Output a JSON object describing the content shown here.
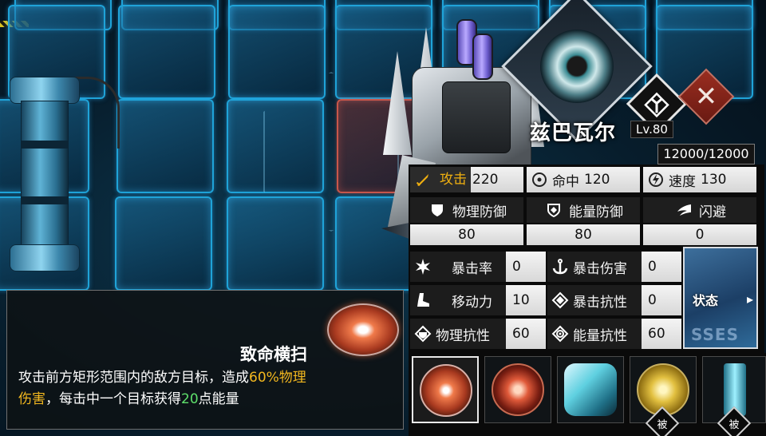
{
  "character": {
    "name": "兹巴瓦尔",
    "level": "Lv.80",
    "hp": "12000/12000"
  },
  "stats": {
    "attack": {
      "label": "攻击",
      "value": "220"
    },
    "accuracy": {
      "label": "命中",
      "value": "120"
    },
    "speed": {
      "label": "速度",
      "value": "130"
    },
    "phys_def": {
      "label": "物理防御",
      "value": "80"
    },
    "energy_def": {
      "label": "能量防御",
      "value": "80"
    },
    "evasion": {
      "label": "闪避",
      "value": "0"
    },
    "crit_rate": {
      "label": "暴击率",
      "value": "0"
    },
    "crit_dmg": {
      "label": "暴击伤害",
      "value": "0"
    },
    "mobility": {
      "label": "移动力",
      "value": "10"
    },
    "crit_res": {
      "label": "暴击抗性",
      "value": "0"
    },
    "phys_res": {
      "label": "物理抗性",
      "value": "60"
    },
    "energy_res": {
      "label": "能量抗性",
      "value": "60"
    }
  },
  "status_card": {
    "label": "状态",
    "watermark": "SSES"
  },
  "skill": {
    "title": "致命横扫",
    "desc_1": "攻击前方矩形范围内的敌方目标，造成",
    "desc_2": "60%物理",
    "desc_3": "伤害",
    "desc_4": "，每击中一个目标获得",
    "desc_5": "20",
    "desc_6": "点能量"
  },
  "skills_bar": {
    "passive_label": "被"
  },
  "colors": {
    "highlight_yellow": "#f3b81f",
    "highlight_green": "#5ee06b",
    "close_red": "#8a2418",
    "grid_blue": "#1fa3d8"
  }
}
